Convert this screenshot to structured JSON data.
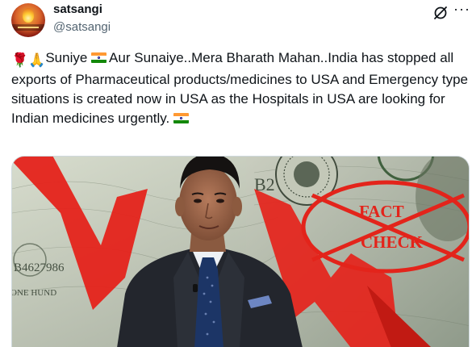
{
  "author": {
    "name": "satsangi",
    "handle": "@satsangi",
    "avatar_icon": "avatar-logo"
  },
  "header_icons": [
    "grok-icon",
    "more-icon"
  ],
  "tweet": {
    "segments": [
      {
        "type": "emoji",
        "icon": "rose-icon",
        "char": "🌹"
      },
      {
        "type": "emoji",
        "icon": "folded-hands-icon",
        "char": "🙏"
      },
      {
        "type": "text",
        "text": "Suniye "
      },
      {
        "type": "flag",
        "icon": "india-flag-icon"
      },
      {
        "type": "text",
        "text": "Aur Sunaiye..Mera Bharath Mahan..India has stopped all exports of Pharmaceutical products/medicines to USA and Emergency type situations is created now in USA as the Hospitals in USA are looking for Indian medicines urgently. "
      },
      {
        "type": "flag",
        "icon": "india-flag-icon"
      }
    ]
  },
  "media": {
    "stamp_line1": "FACT",
    "stamp_line2": "CHECK",
    "banknote_serial": "B4627986",
    "banknote_letters": "B2",
    "banknote_corner_text": "ONE HUND",
    "colors": {
      "arrow": "#e5231b",
      "stamp": "#e3241b",
      "suit": "#23262d",
      "tie": "#1c3566"
    }
  }
}
